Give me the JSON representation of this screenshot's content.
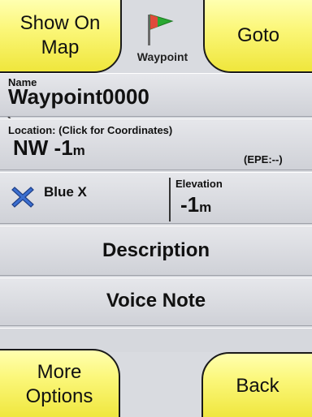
{
  "header": {
    "show_on_map_line1": "Show On",
    "show_on_map_line2": "Map",
    "goto_label": "Goto",
    "waypoint_caption": "Waypoint",
    "waypoint_icon": "green-flag-icon"
  },
  "name": {
    "label": "Name",
    "value": "Waypoint0000"
  },
  "location": {
    "label": "Location: (Click for Coordinates)",
    "value": "NW -1",
    "unit": "m",
    "epe": "(EPE:--)"
  },
  "symbol": {
    "icon": "blue-x-icon",
    "name": "Blue X"
  },
  "elevation": {
    "label": "Elevation",
    "value": "-1",
    "unit": "m"
  },
  "description_label": "Description",
  "voice_note_label": "Voice Note",
  "footer": {
    "more_line1": "More",
    "more_line2": "Options",
    "back_label": "Back"
  },
  "colors": {
    "button_yellow": "#f7f16a",
    "row_gray": "#d9dbe0",
    "x_blue": "#3b6fd1"
  }
}
